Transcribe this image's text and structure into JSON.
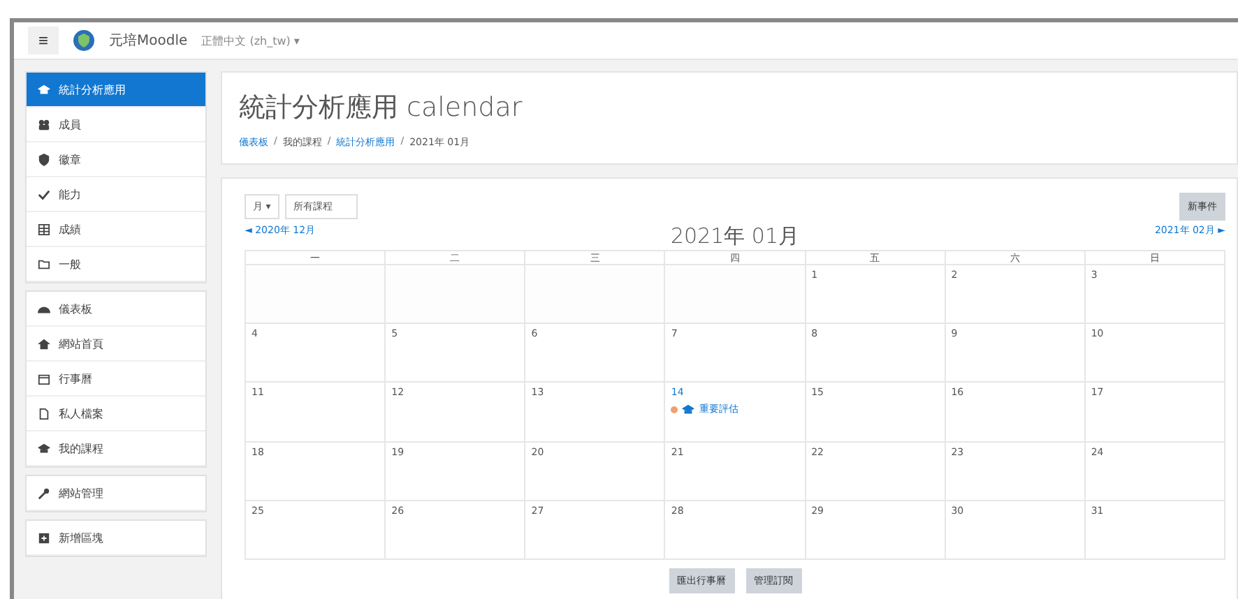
{
  "navbar": {
    "menu_icon": "≡",
    "site_name": "元培Moodle",
    "language": "正體中文 (zh_tw) ▾"
  },
  "sidebar": {
    "groups": [
      [
        {
          "label": "統計分析應用",
          "selected": true
        },
        {
          "label": "成員",
          "selected": false
        },
        {
          "label": "徽章",
          "selected": false
        },
        {
          "label": "能力",
          "selected": false
        },
        {
          "label": "成績",
          "selected": false
        },
        {
          "label": "一般",
          "selected": false
        }
      ],
      [
        {
          "label": "儀表板",
          "selected": false
        },
        {
          "label": "網站首頁",
          "selected": false
        },
        {
          "label": "行事曆",
          "selected": false
        },
        {
          "label": "私人檔案",
          "selected": false
        },
        {
          "label": "我的課程",
          "selected": false
        }
      ],
      [
        {
          "label": "網站管理",
          "selected": false
        }
      ],
      [
        {
          "label": "新增區塊",
          "selected": false
        }
      ]
    ]
  },
  "header": {
    "title": "統計分析應用 calendar",
    "separator": "/",
    "breadcrumb": [
      {
        "label": "儀表板",
        "link": true
      },
      {
        "label": "我的課程",
        "link": false
      },
      {
        "label": "統計分析應用",
        "link": true
      },
      {
        "label": "2021年 01月",
        "link": false
      }
    ]
  },
  "calendar": {
    "view_select": "月 ▾",
    "course_select": "所有課程",
    "new_event": "新事件",
    "prev": "◄ 2020年 12月",
    "month": "2021年 01月",
    "next": "2021年 02月 ►",
    "weekdays": [
      "一",
      "二",
      "三",
      "四",
      "五",
      "六",
      "日"
    ],
    "weeks": [
      [
        {
          "kind": "blank"
        },
        {
          "kind": "blank"
        },
        {
          "kind": "blank"
        },
        {
          "kind": "blank"
        },
        {
          "kind": "day",
          "day": "1"
        },
        {
          "kind": "day",
          "day": "2"
        },
        {
          "kind": "day",
          "day": "3"
        }
      ],
      [
        {
          "kind": "day",
          "day": "4"
        },
        {
          "kind": "day",
          "day": "5"
        },
        {
          "kind": "day",
          "day": "6"
        },
        {
          "kind": "day",
          "day": "7"
        },
        {
          "kind": "day",
          "day": "8"
        },
        {
          "kind": "day",
          "day": "9"
        },
        {
          "kind": "day",
          "day": "10"
        }
      ],
      [
        {
          "kind": "day",
          "day": "11"
        },
        {
          "kind": "day",
          "day": "12"
        },
        {
          "kind": "day",
          "day": "13"
        },
        {
          "kind": "day",
          "day": "14",
          "today": true,
          "events": [
            {
              "label": "重要評估",
              "color": "#f0a070"
            }
          ]
        },
        {
          "kind": "day",
          "day": "15"
        },
        {
          "kind": "day",
          "day": "16"
        },
        {
          "kind": "day",
          "day": "17"
        }
      ],
      [
        {
          "kind": "day",
          "day": "18"
        },
        {
          "kind": "day",
          "day": "19"
        },
        {
          "kind": "day",
          "day": "20"
        },
        {
          "kind": "day",
          "day": "21"
        },
        {
          "kind": "day",
          "day": "22"
        },
        {
          "kind": "day",
          "day": "23"
        },
        {
          "kind": "day",
          "day": "24"
        }
      ],
      [
        {
          "kind": "day",
          "day": "25"
        },
        {
          "kind": "day",
          "day": "26"
        },
        {
          "kind": "day",
          "day": "27"
        },
        {
          "kind": "day",
          "day": "28"
        },
        {
          "kind": "day",
          "day": "29"
        },
        {
          "kind": "day",
          "day": "30"
        },
        {
          "kind": "day",
          "day": "31"
        }
      ]
    ],
    "buttons": [
      "匯出行事曆",
      "管理訂閱"
    ]
  }
}
